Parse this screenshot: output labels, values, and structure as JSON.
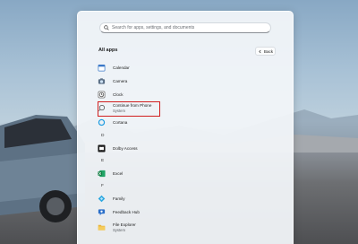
{
  "search": {
    "placeholder": "Search for apps, settings, and documents"
  },
  "all_apps": {
    "title": "All apps",
    "back_label": "Back"
  },
  "apps": {
    "calendar": "Calendar",
    "camera": "Camera",
    "clock": "Clock",
    "continue_from_phone": {
      "name": "Continue from Phone",
      "sub": "System"
    },
    "cortana": "Cortana",
    "dolby_access": "Dolby Access",
    "excel": "Excel",
    "family": "Family",
    "feedback_hub": "Feedback Hub",
    "file_explorer": {
      "name": "File Explorer",
      "sub": "System"
    }
  },
  "letters": {
    "d": "D",
    "e": "E",
    "f": "F"
  },
  "colors": {
    "highlight": "#d11f1f",
    "accent": "#0a64c8"
  }
}
